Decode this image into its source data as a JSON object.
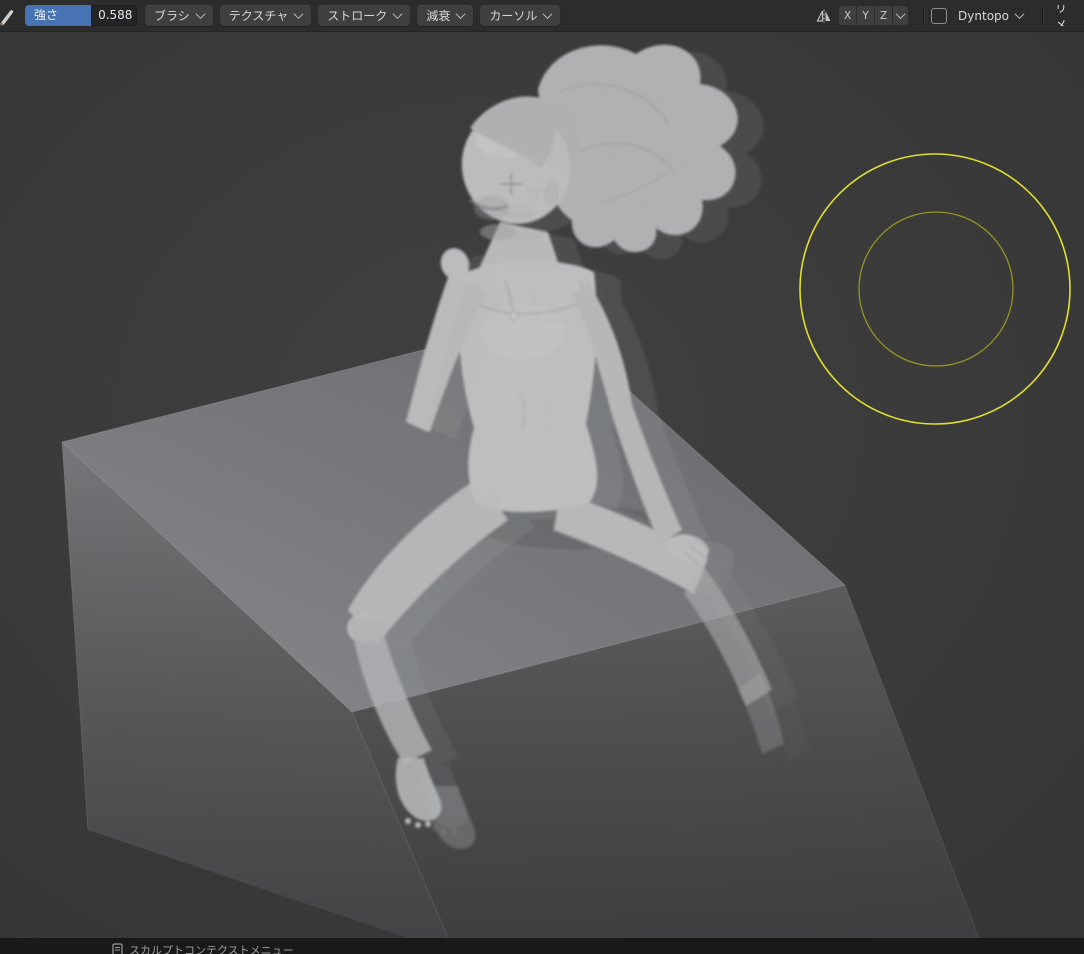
{
  "header": {
    "strength": {
      "label": "強さ",
      "value": "0.588",
      "fill_pct": 59
    },
    "dropdowns": [
      {
        "label": "ブラシ"
      },
      {
        "label": "テクスチャ"
      },
      {
        "label": "ストローク"
      },
      {
        "label": "減衰"
      },
      {
        "label": "カーソル"
      }
    ],
    "mirror_axes": [
      {
        "label": "X"
      },
      {
        "label": "Y"
      },
      {
        "label": "Z"
      }
    ],
    "dyntopo_label": "Dyntopo",
    "remesh_label": "リメ",
    "accent": "#4772b3"
  },
  "viewport": {
    "cursor_outer": "#e2dd2e",
    "cursor_inner": "#97921f"
  },
  "statusbar": {
    "label": "スカルプトコンテクストメニュー"
  }
}
